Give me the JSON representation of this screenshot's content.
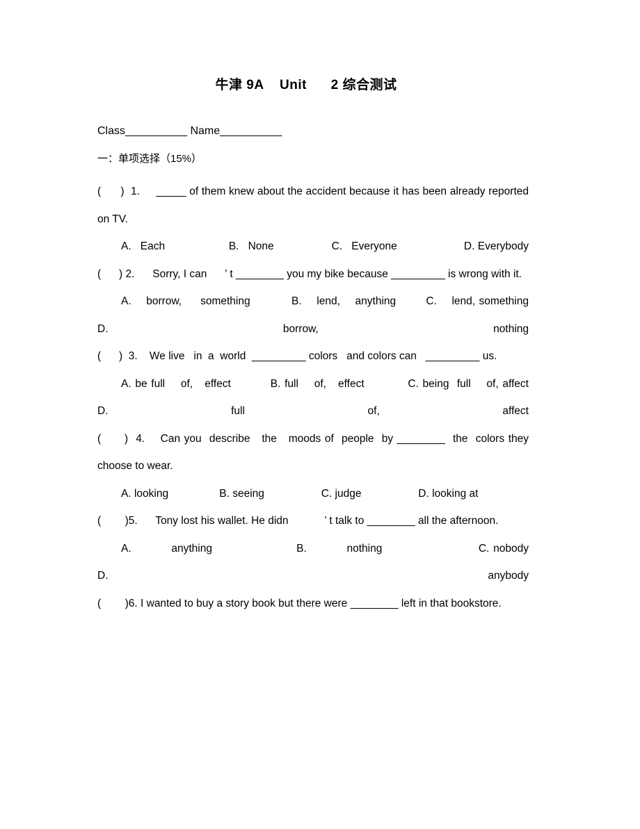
{
  "document": {
    "title": "牛津 9A    Unit      2 综合测试",
    "id_line": "Class__________ Name__________",
    "section_heading": "一：单项选择（15%）"
  },
  "questions": [
    {
      "stem": "(      )  1.     _____ of them knew about the accident because it has been already reported on TV.",
      "options": "A.   Each                     B.   None                   C.   Everyone                      D. Everybody"
    },
    {
      "stem": "(      ) 2.      Sorry, I can      ’ t ________ you my bike because _________ is wrong with it.",
      "options": "A.    borrow,     something           B.    lend,    anything        C.    lend, something              D. borrow, nothing"
    },
    {
      "stem": "(      )  3.    We live   in  a  world  _________ colors   and colors can   _________ us.",
      "options": "A. be full    of,   effect          B. full    of,   effect           C. being  full    of, affect              D. full of, affect"
    },
    {
      "stem": "(      )  4.    Can you  describe   the   moods of  people  by ________  the  colors they choose to wear.",
      "options": "A. looking                 B. seeing                   C. judge                   D. looking at"
    },
    {
      "stem": "(        )5.      Tony lost his wallet. He didn            ’ t talk to ________ all the afternoon.",
      "options": "A.          anything                     B.          nothing                        C. nobody                    D. anybody"
    },
    {
      "stem": "(        )6. I wanted to buy a story book but there were ________ left in that bookstore.",
      "options": ""
    }
  ]
}
